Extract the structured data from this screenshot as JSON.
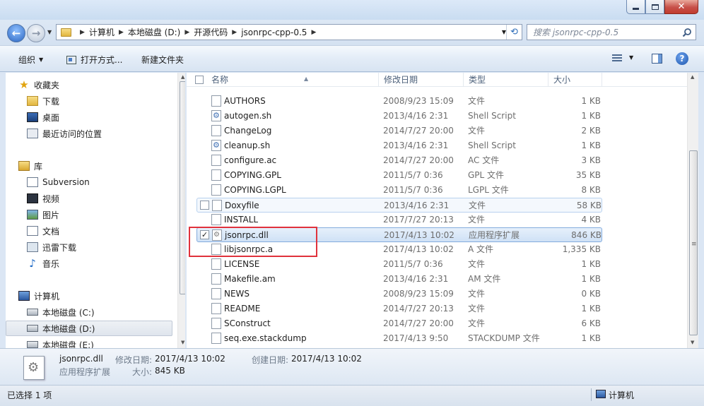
{
  "window": {
    "minimize": "",
    "maximize": "",
    "close": "✕"
  },
  "address": {
    "crumbs": [
      "计算机",
      "本地磁盘 (D:)",
      "开源代码",
      "jsonrpc-cpp-0.5"
    ],
    "search_placeholder": "搜索 jsonrpc-cpp-0.5"
  },
  "toolbar": {
    "organize": "组织",
    "open_with": "打开方式...",
    "new_folder": "新建文件夹",
    "help": "?"
  },
  "navpane": {
    "items": [
      {
        "label": "收藏夹",
        "icon": "star-icon"
      },
      {
        "label": "下载",
        "icon": "downloads-folder-icon"
      },
      {
        "label": "桌面",
        "icon": "desktop-icon"
      },
      {
        "label": "最近访问的位置",
        "icon": "recent-places-icon"
      },
      {
        "label": "库",
        "icon": "libraries-icon"
      },
      {
        "label": "Subversion",
        "icon": "subversion-library-icon"
      },
      {
        "label": "视频",
        "icon": "videos-icon"
      },
      {
        "label": "图片",
        "icon": "pictures-icon"
      },
      {
        "label": "文档",
        "icon": "documents-icon"
      },
      {
        "label": "迅雷下载",
        "icon": "xunlei-download-icon"
      },
      {
        "label": "音乐",
        "icon": "music-icon"
      },
      {
        "label": "计算机",
        "icon": "computer-icon"
      },
      {
        "label": "本地磁盘 (C:)",
        "icon": "drive-c-icon"
      },
      {
        "label": "本地磁盘 (D:)",
        "icon": "drive-d-icon"
      },
      {
        "label": "本地磁盘 (E:)",
        "icon": "drive-e-icon"
      }
    ]
  },
  "columns": {
    "name": "名称",
    "date": "修改日期",
    "type": "类型",
    "size": "大小"
  },
  "files": [
    {
      "name": "AUTHORS",
      "date": "2008/9/23 15:09",
      "type": "文件",
      "size": "1 KB"
    },
    {
      "name": "autogen.sh",
      "date": "2013/4/16 2:31",
      "type": "Shell Script",
      "size": "1 KB"
    },
    {
      "name": "ChangeLog",
      "date": "2014/7/27 20:00",
      "type": "文件",
      "size": "2 KB"
    },
    {
      "name": "cleanup.sh",
      "date": "2013/4/16 2:31",
      "type": "Shell Script",
      "size": "1 KB"
    },
    {
      "name": "configure.ac",
      "date": "2014/7/27 20:00",
      "type": "AC 文件",
      "size": "3 KB"
    },
    {
      "name": "COPYING.GPL",
      "date": "2011/5/7 0:36",
      "type": "GPL 文件",
      "size": "35 KB"
    },
    {
      "name": "COPYING.LGPL",
      "date": "2011/5/7 0:36",
      "type": "LGPL 文件",
      "size": "8 KB"
    },
    {
      "name": "Doxyfile",
      "date": "2013/4/16 2:31",
      "type": "文件",
      "size": "58 KB"
    },
    {
      "name": "INSTALL",
      "date": "2017/7/27 20:13",
      "type": "文件",
      "size": "4 KB"
    },
    {
      "name": "jsonrpc.dll",
      "date": "2017/4/13 10:02",
      "type": "应用程序扩展",
      "size": "846 KB"
    },
    {
      "name": "libjsonrpc.a",
      "date": "2017/4/13 10:02",
      "type": "A 文件",
      "size": "1,335 KB"
    },
    {
      "name": "LICENSE",
      "date": "2011/5/7 0:36",
      "type": "文件",
      "size": "1 KB"
    },
    {
      "name": "Makefile.am",
      "date": "2013/4/16 2:31",
      "type": "AM 文件",
      "size": "1 KB"
    },
    {
      "name": "NEWS",
      "date": "2008/9/23 15:09",
      "type": "文件",
      "size": "0 KB"
    },
    {
      "name": "README",
      "date": "2014/7/27 20:13",
      "type": "文件",
      "size": "1 KB"
    },
    {
      "name": "SConstruct",
      "date": "2014/7/27 20:00",
      "type": "文件",
      "size": "6 KB"
    },
    {
      "name": "seq.exe.stackdump",
      "date": "2017/4/13 9:50",
      "type": "STACKDUMP 文件",
      "size": "1 KB"
    }
  ],
  "details": {
    "filename": "jsonrpc.dll",
    "filetype": "应用程序扩展",
    "modified_label": "修改日期:",
    "modified_value": "2017/4/13 10:02",
    "size_label": "大小:",
    "size_value": "845 KB",
    "created_label": "创建日期:",
    "created_value": "2017/4/13 10:02"
  },
  "status": {
    "selected": "已选择 1 项",
    "location": "计算机"
  }
}
